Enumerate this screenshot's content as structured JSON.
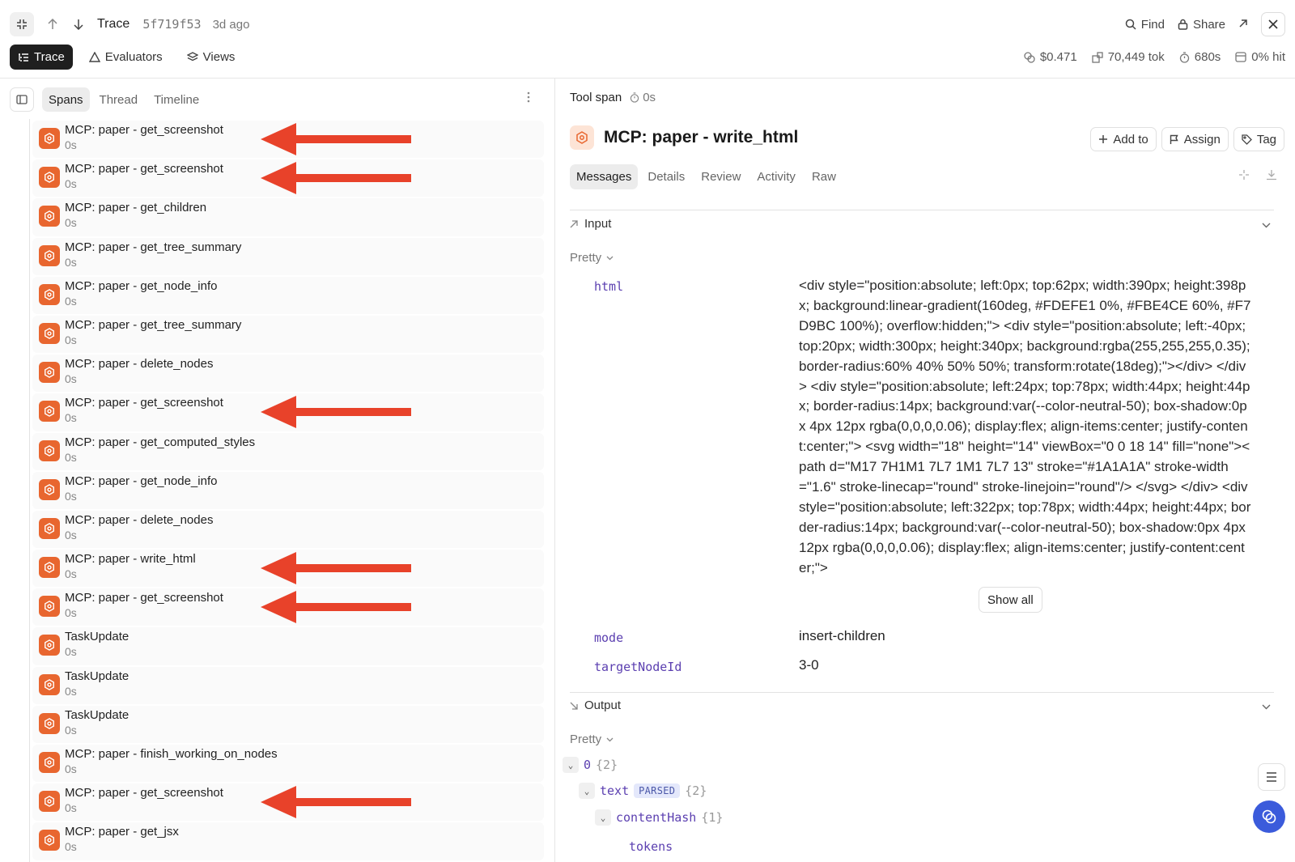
{
  "header": {
    "title": "Trace",
    "trace_id": "5f719f53",
    "age": "3d ago",
    "find_label": "Find",
    "share_label": "Share",
    "tabs": [
      {
        "label": "Trace",
        "icon": "list-tree-icon",
        "active": true
      },
      {
        "label": "Evaluators",
        "icon": "triangle-icon",
        "active": false
      },
      {
        "label": "Views",
        "icon": "layers-icon",
        "active": false
      }
    ],
    "stats": {
      "cost": "$0.471",
      "tokens": "70,449 tok",
      "duration": "680s",
      "cache_hit": "0% hit"
    }
  },
  "left_pane": {
    "tabs": [
      "Spans",
      "Thread",
      "Timeline"
    ],
    "active_tab": "Spans",
    "spans": [
      {
        "name": "MCP: paper - get_screenshot",
        "duration": "0s",
        "arrow": true
      },
      {
        "name": "MCP: paper - get_screenshot",
        "duration": "0s",
        "arrow": true
      },
      {
        "name": "MCP: paper - get_children",
        "duration": "0s",
        "arrow": false
      },
      {
        "name": "MCP: paper - get_tree_summary",
        "duration": "0s",
        "arrow": false
      },
      {
        "name": "MCP: paper - get_node_info",
        "duration": "0s",
        "arrow": false
      },
      {
        "name": "MCP: paper - get_tree_summary",
        "duration": "0s",
        "arrow": false
      },
      {
        "name": "MCP: paper - delete_nodes",
        "duration": "0s",
        "arrow": false
      },
      {
        "name": "MCP: paper - get_screenshot",
        "duration": "0s",
        "arrow": true
      },
      {
        "name": "MCP: paper - get_computed_styles",
        "duration": "0s",
        "arrow": false
      },
      {
        "name": "MCP: paper - get_node_info",
        "duration": "0s",
        "arrow": false
      },
      {
        "name": "MCP: paper - delete_nodes",
        "duration": "0s",
        "arrow": false
      },
      {
        "name": "MCP: paper - write_html",
        "duration": "0s",
        "arrow": true
      },
      {
        "name": "MCP: paper - get_screenshot",
        "duration": "0s",
        "arrow": true
      },
      {
        "name": "TaskUpdate",
        "duration": "0s",
        "arrow": false
      },
      {
        "name": "TaskUpdate",
        "duration": "0s",
        "arrow": false
      },
      {
        "name": "TaskUpdate",
        "duration": "0s",
        "arrow": false
      },
      {
        "name": "MCP: paper - finish_working_on_nodes",
        "duration": "0s",
        "arrow": false
      },
      {
        "name": "MCP: paper - get_screenshot",
        "duration": "0s",
        "arrow": true
      },
      {
        "name": "MCP: paper - get_jsx",
        "duration": "0s",
        "arrow": false
      }
    ]
  },
  "detail": {
    "kind": "Tool span",
    "duration": "0s",
    "title": "MCP: paper - write_html",
    "actions": [
      "Add to",
      "Assign",
      "Tag"
    ],
    "tabs": [
      "Messages",
      "Details",
      "Review",
      "Activity",
      "Raw"
    ],
    "active_tab": "Messages",
    "input": {
      "label": "Input",
      "view": "Pretty",
      "html_key": "html",
      "html_value": "<div style=\"position:absolute; left:0px; top:62px; width:390px; height:398px; background:linear-gradient(160deg, #FDEFE1 0%, #FBE4CE 60%, #F7D9BC 100%); overflow:hidden;\"> <div style=\"position:absolute; left:-40px; top:20px; width:300px; height:340px; background:rgba(255,255,255,0.35); border-radius:60% 40% 50% 50%; transform:rotate(18deg);\"></div> </div> <div style=\"position:absolute; left:24px; top:78px; width:44px; height:44px; border-radius:14px; background:var(--color-neutral-50); box-shadow:0px 4px 12px rgba(0,0,0,0.06); display:flex; align-items:center; justify-content:center;\"> <svg width=\"18\" height=\"14\" viewBox=\"0 0 18 14\" fill=\"none\"><path d=\"M17 7H1M1 7L7 1M1 7L7 13\" stroke=\"#1A1A1A\" stroke-width=\"1.6\" stroke-linecap=\"round\" stroke-linejoin=\"round\"/> </svg> </div> <div style=\"position:absolute; left:322px; top:78px; width:44px; height:44px; border-radius:14px; background:var(--color-neutral-50); box-shadow:0px 4px 12px rgba(0,0,0,0.06); display:flex; align-items:center; justify-content:center;\">",
      "show_all_label": "Show all",
      "mode_key": "mode",
      "mode_value": "insert-children",
      "target_key": "targetNodeId",
      "target_value": "3-0"
    },
    "output": {
      "label": "Output",
      "view": "Pretty",
      "nodes": [
        {
          "key": "0",
          "count": "{2}"
        },
        {
          "key": "text",
          "badge": "PARSED",
          "count": "{2}"
        },
        {
          "key": "contentHash",
          "count": "{1}"
        },
        {
          "key": "tokens",
          "count": ""
        }
      ]
    }
  },
  "colors": {
    "span_icon": "#e8662f",
    "arrow": "#e8422a",
    "key_purple": "#5b3fb0",
    "fab_blue": "#3b5bdb"
  }
}
